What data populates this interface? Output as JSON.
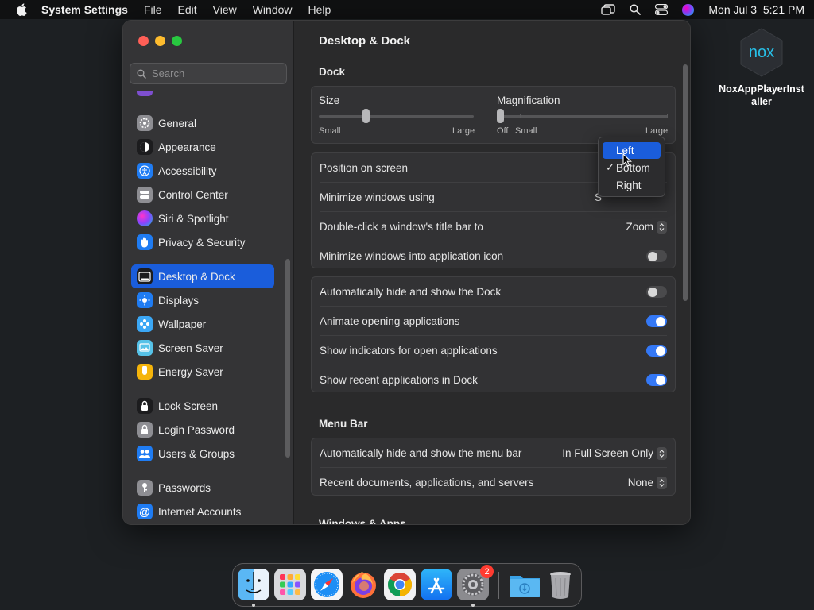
{
  "menubar": {
    "app_name": "System Settings",
    "menus": [
      "File",
      "Edit",
      "View",
      "Window",
      "Help"
    ],
    "clock": "Mon Jul 3  5:21 PM"
  },
  "desktop": {
    "icon_label_line1": "NoxAppPlayerInst",
    "icon_label_line2": "aller",
    "logo_text": "nox"
  },
  "sidebar": {
    "search_placeholder": "Search",
    "items": [
      {
        "label": "General",
        "icon": "gear-icon",
        "color": "#8e8e93"
      },
      {
        "label": "Appearance",
        "icon": "appearance-icon",
        "color": "#1c1c1e"
      },
      {
        "label": "Accessibility",
        "icon": "accessibility-icon",
        "color": "#1f7cf3"
      },
      {
        "label": "Control Center",
        "icon": "control-center-icon",
        "color": "#8e8e93"
      },
      {
        "label": "Siri & Spotlight",
        "icon": "siri-icon",
        "color": "#b04fe8"
      },
      {
        "label": "Privacy & Security",
        "icon": "hand-icon",
        "color": "#1f7cf3"
      },
      {
        "label": "Desktop & Dock",
        "icon": "dock-icon",
        "color": "#1c1c1e"
      },
      {
        "label": "Displays",
        "icon": "displays-icon",
        "color": "#1f7cf3"
      },
      {
        "label": "Wallpaper",
        "icon": "wallpaper-icon",
        "color": "#3ba7f5"
      },
      {
        "label": "Screen Saver",
        "icon": "screen-saver-icon",
        "color": "#56c2e8"
      },
      {
        "label": "Energy Saver",
        "icon": "energy-icon",
        "color": "#f5b40a"
      },
      {
        "label": "Lock Screen",
        "icon": "lock-icon",
        "color": "#1c1c1e"
      },
      {
        "label": "Login Password",
        "icon": "login-lock-icon",
        "color": "#8e8e93"
      },
      {
        "label": "Users & Groups",
        "icon": "users-icon",
        "color": "#1f7cf3"
      },
      {
        "label": "Passwords",
        "icon": "key-icon",
        "color": "#8e8e93"
      },
      {
        "label": "Internet Accounts",
        "icon": "at-icon",
        "color": "#1f7cf3"
      }
    ],
    "selected": "Desktop & Dock"
  },
  "content": {
    "title": "Desktop & Dock",
    "dock_section": "Dock",
    "size_label": "Size",
    "size_min": "Small",
    "size_max": "Large",
    "size_value": 0.3,
    "magnification_label": "Magnification",
    "mag_off": "Off",
    "mag_min": "Small",
    "mag_max": "Large",
    "mag_value": 0.0,
    "position_label": "Position on screen",
    "minimize_label": "Minimize windows using",
    "minimize_value_partial": "S",
    "double_click_label": "Double-click a window's title bar to",
    "double_click_value": "Zoom",
    "minimize_into_icon_label": "Minimize windows into application icon",
    "minimize_into_icon_on": false,
    "autohide_label": "Automatically hide and show the Dock",
    "autohide_on": false,
    "animate_label": "Animate opening applications",
    "animate_on": true,
    "indicators_label": "Show indicators for open applications",
    "indicators_on": true,
    "recent_label": "Show recent applications in Dock",
    "recent_on": true,
    "menubar_section": "Menu Bar",
    "menubar_autohide_label": "Automatically hide and show the menu bar",
    "menubar_autohide_value": "In Full Screen Only",
    "recent_docs_label": "Recent documents, applications, and servers",
    "recent_docs_value": "None",
    "next_section_partial": "Windows & Apps"
  },
  "popup": {
    "options": [
      "Left",
      "Bottom",
      "Right"
    ],
    "checked": "Bottom",
    "highlighted": "Left",
    "check_mark": "✓"
  },
  "dock": {
    "apps": [
      "Finder",
      "Launchpad",
      "Safari",
      "Firefox",
      "Chrome",
      "App Store",
      "System Settings",
      "Downloads",
      "Trash"
    ],
    "settings_badge": "2"
  },
  "colors": {
    "accent": "#1a5ddb",
    "toggle_on": "#3478f6"
  }
}
